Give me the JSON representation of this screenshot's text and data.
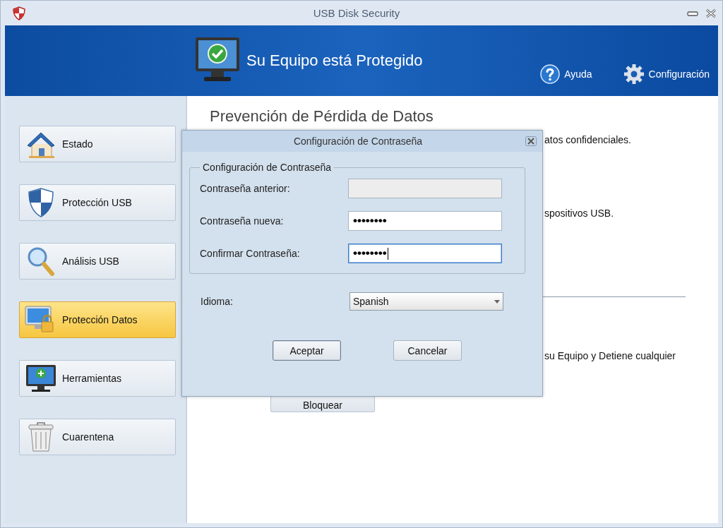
{
  "window": {
    "title": "USB Disk Security"
  },
  "header": {
    "status": "Su Equipo está Protegido",
    "actions": [
      {
        "label": "Ayuda"
      },
      {
        "label": "Configuración"
      }
    ]
  },
  "sidebar": {
    "items": [
      {
        "label": "Estado",
        "selected": false
      },
      {
        "label": "Protección USB",
        "selected": false
      },
      {
        "label": "Análisis USB",
        "selected": false
      },
      {
        "label": "Protección Datos",
        "selected": true
      },
      {
        "label": "Herramientas",
        "selected": false
      },
      {
        "label": "Cuarentena",
        "selected": false
      }
    ]
  },
  "content": {
    "title": "Prevención de Pérdida de Datos",
    "texts": [
      "atos confidenciales.",
      "spositivos USB.",
      "su Equipo y Detiene cualquier"
    ],
    "button": "Bloquear"
  },
  "dialog": {
    "title": "Configuración de Contraseña",
    "group_title": "Configuración de Contraseña",
    "fields": [
      {
        "label": "Contraseña anterior:",
        "disabled": true,
        "focused": false
      },
      {
        "label": "Contraseña nueva:",
        "value": "••••••••",
        "disabled": false,
        "focused": false
      },
      {
        "label": "Confirmar Contraseña:",
        "value": "••••••••",
        "disabled": false,
        "focused": true
      }
    ],
    "language": {
      "label": "Idioma:",
      "value": "Spanish"
    },
    "buttons": [
      {
        "label": "Aceptar",
        "default": true
      },
      {
        "label": "Cancelar",
        "default": false
      }
    ]
  }
}
